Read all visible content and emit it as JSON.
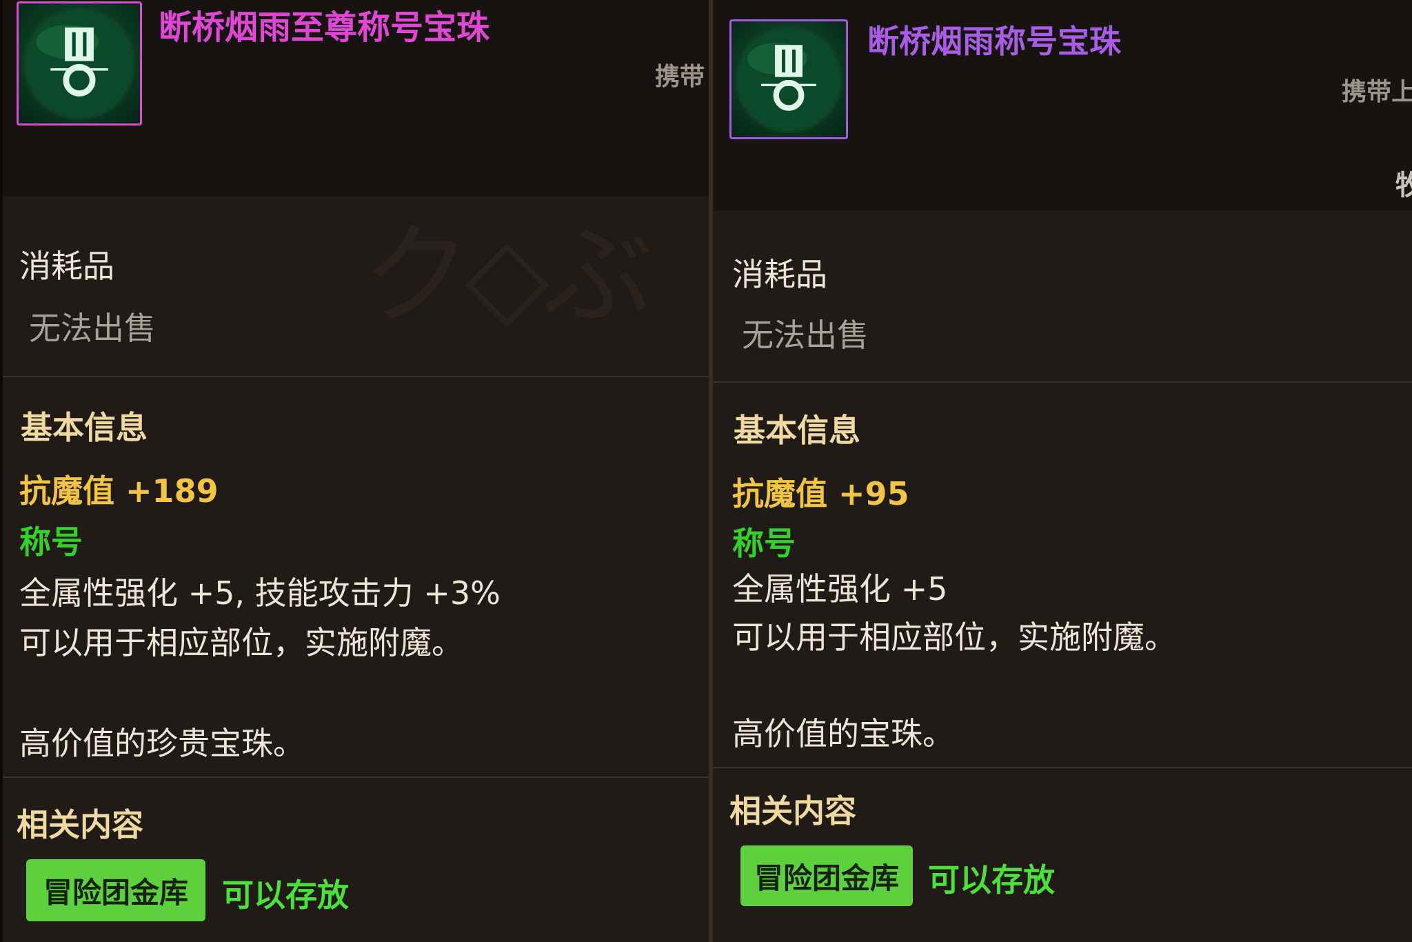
{
  "left": {
    "item_name": "断桥烟雨至尊称号宝珠",
    "carry_text": "携带",
    "category": "消耗品",
    "sell_status": "无法出售",
    "basic_header": "基本信息",
    "stat": "抗魔值 +189",
    "title_label": "称号",
    "effect": "全属性强化 +5, 技能攻击力 +3%",
    "usage": "可以用于相应部位，实施附魔。",
    "flavor": "高价值的珍贵宝珠。",
    "related_header": "相关内容",
    "vault_button": "冒险团金库",
    "storable": "可以存放",
    "icon": "title-orb-icon",
    "frame_color": "#d84bd3"
  },
  "right": {
    "item_name": "断桥烟雨称号宝珠",
    "carry_text": "携带上",
    "category": "消耗品",
    "sell_status": "无法出售",
    "basic_header": "基本信息",
    "stat": "抗魔值 +95",
    "title_label": "称号",
    "effect": "全属性强化 +5",
    "usage": "可以用于相应部位，实施附魔。",
    "flavor": "高价值的宝珠。",
    "related_header": "相关内容",
    "vault_button": "冒险团金库",
    "storable": "可以存放",
    "partial_char": "牧",
    "icon": "title-orb-icon",
    "frame_color": "#a55ae0"
  },
  "colors": {
    "stat": "#f1c443",
    "title_label": "#35d12b",
    "section": "#efd9a0",
    "button": "#5ed03e"
  }
}
